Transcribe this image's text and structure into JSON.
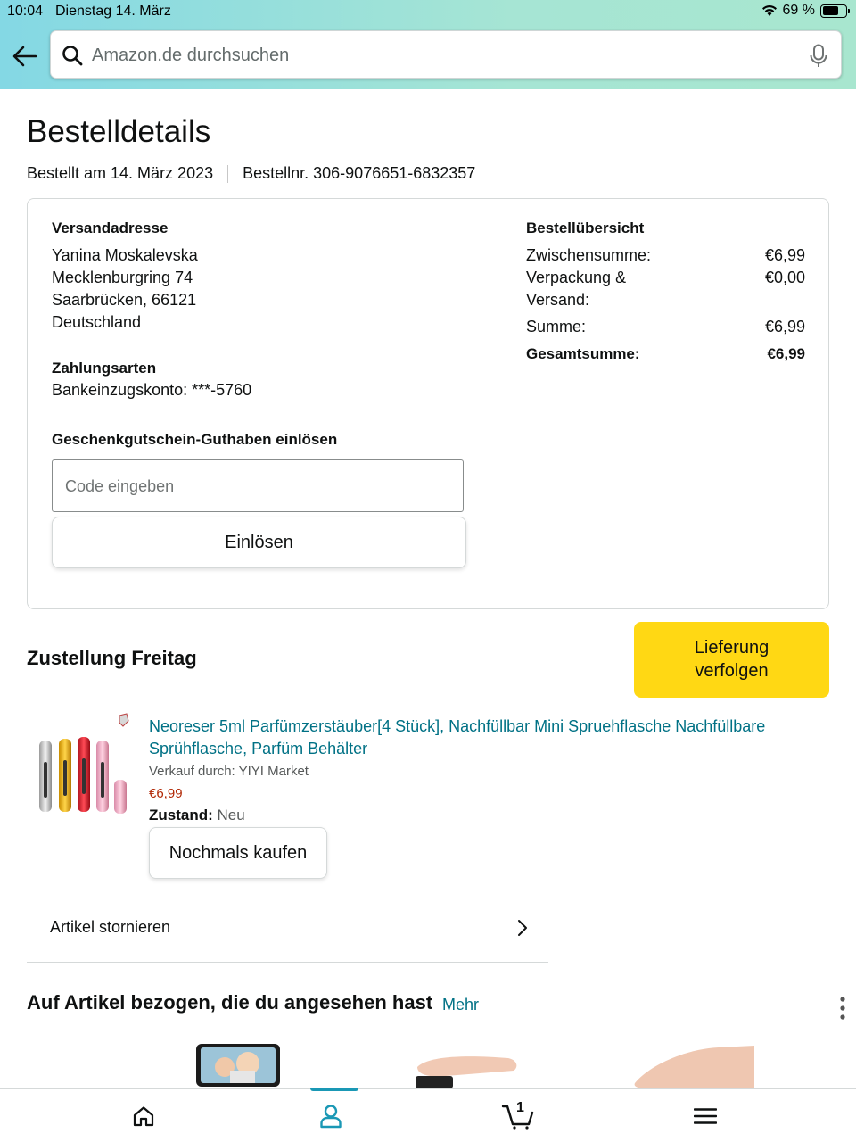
{
  "status_bar": {
    "time": "10:04",
    "date": "Dienstag 14. März",
    "battery": "69 %",
    "battery_level": 0.69
  },
  "search": {
    "placeholder": "Amazon.de durchsuchen"
  },
  "page": {
    "title": "Bestelldetails",
    "ordered_on": "Bestellt am 14. März 2023",
    "order_number": "Bestellnr. 306-9076651-6832357"
  },
  "shipping": {
    "heading": "Versandadresse",
    "name": "Yanina Moskalevska",
    "street": "Mecklenburgring 74",
    "city": "Saarbrücken, 66121",
    "country": "Deutschland"
  },
  "payment": {
    "heading": "Zahlungsarten",
    "method": "Bankeinzugskonto: ***-5760"
  },
  "gift_card": {
    "heading": "Geschenkgutschein-Guthaben einlösen",
    "placeholder": "Code eingeben",
    "button": "Einlösen"
  },
  "summary": {
    "heading": "Bestellübersicht",
    "subtotal_label": "Zwischensumme:",
    "subtotal_value": "€6,99",
    "shipping_label_1": "Verpackung &",
    "shipping_label_2": "Versand:",
    "shipping_value": "€0,00",
    "sum_label": "Summe:",
    "sum_value": "€6,99",
    "total_label": "Gesamtsumme:",
    "total_value": "€6,99"
  },
  "delivery": {
    "heading": "Zustellung Freitag",
    "track_line1": "Lieferung",
    "track_line2": "verfolgen"
  },
  "product": {
    "title": "Neoreser 5ml Parfümzerstäuber[4 Stück], Nachfüllbar Mini Spruehflasche Nachfüllbare Sprühflasche, Parfüm Behälter",
    "seller": "Verkauf durch: YIYI Market",
    "price": "€6,99",
    "condition_label": "Zustand:",
    "condition_value": "Neu",
    "buy_again": "Nochmals kaufen"
  },
  "cancel": {
    "label": "Artikel stornieren"
  },
  "recommendations": {
    "heading": "Auf Artikel bezogen, die du angesehen hast",
    "more": "Mehr"
  },
  "bottom_nav": {
    "items": [
      "home-icon",
      "account-icon",
      "cart-icon",
      "menu-icon"
    ],
    "cart_count": "1",
    "active": "account-icon",
    "accent_color": "#1a98b5"
  },
  "colors": {
    "link": "#007185",
    "price": "#b12704",
    "track_button": "#ffd814"
  }
}
